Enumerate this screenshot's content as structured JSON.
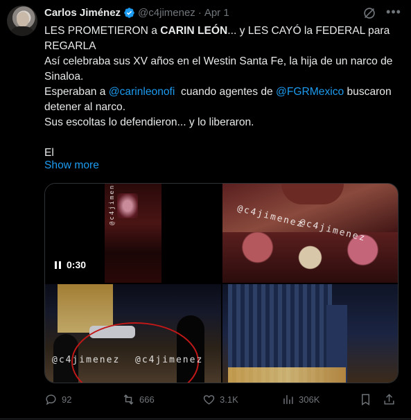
{
  "author": {
    "name": "Carlos Jiménez",
    "handle": "@c4jimenez",
    "separator": "·",
    "date": "Apr 1"
  },
  "tweet": {
    "line1_pre": "LES PROMETIERON a ",
    "line1_bold": "CARIN LEÓN",
    "line1_post": "... y LES CAYÓ la FEDERAL para REGARLA",
    "line2": "Así celebraba sus XV años en el Westin Santa Fe, la hija de un narco de Sinaloa.",
    "line3_pre": "Esperaban a ",
    "line3_mention1": "@carinleonofi",
    "line3_mid": "  cuando agentes de ",
    "line3_mention2": "@FGRMexico",
    "line3_post": " buscaron detener al narco.",
    "line4": "Sus escoltas lo defendieron... y lo liberaron.",
    "line5": "El",
    "show_more": "Show more"
  },
  "media": {
    "video_time": "0:30",
    "watermark": "@c4jimenez"
  },
  "actions": {
    "replies": "92",
    "reposts": "666",
    "likes": "3.1K",
    "views": "306K"
  },
  "icons": [
    "verified-badge-icon",
    "grok-icon",
    "more-icon",
    "reply-icon",
    "repost-icon",
    "like-icon",
    "views-icon",
    "bookmark-icon",
    "share-icon",
    "pause-icon"
  ],
  "colors": {
    "background": "#000000",
    "text": "#e7e9ea",
    "secondary": "#71767b",
    "link": "#1d9bf0"
  }
}
